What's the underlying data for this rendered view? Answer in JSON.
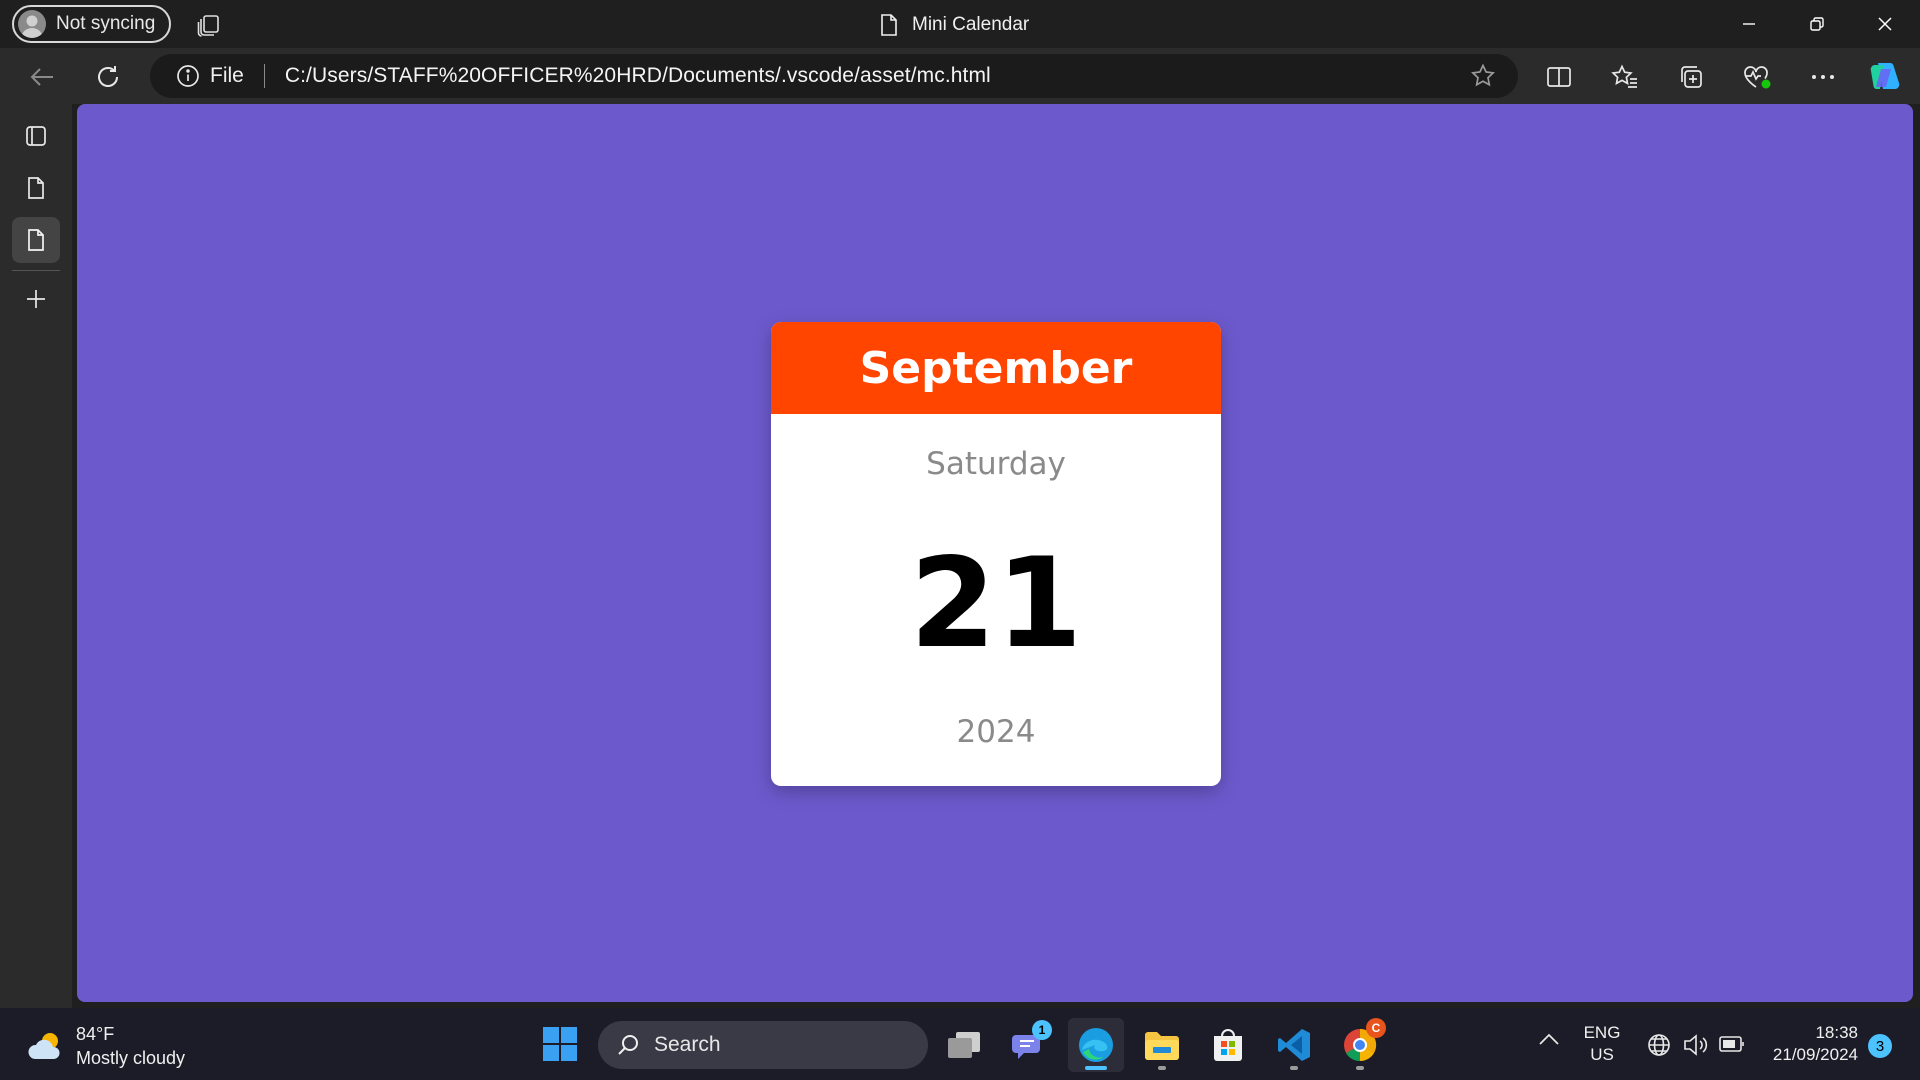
{
  "browser": {
    "profile_label": "Not syncing",
    "window_title": "Mini Calendar",
    "address": {
      "site_info_label": "File",
      "url": "C:/Users/STAFF%20OFFICER%20HRD/Documents/.vscode/asset/mc.html"
    },
    "icons": {
      "back": "back-arrow-icon",
      "refresh": "refresh-icon",
      "site_info": "info-icon",
      "favorite": "star-icon",
      "split_screen": "split-screen-icon",
      "favorites": "favorites-icon",
      "collections": "collections-icon",
      "browser_essentials": "heart-pulse-icon",
      "more": "more-icon",
      "copilot": "copilot-icon"
    },
    "sidebar_tabs": [
      "tab-actions-icon",
      "page-tab-icon",
      "page-tab-icon-active",
      "new-tab-icon"
    ]
  },
  "calendar": {
    "month": "September",
    "weekday": "Saturday",
    "day": "21",
    "year": "2024",
    "colors": {
      "background": "#6c5acd",
      "header": "#ff4500"
    }
  },
  "taskbar": {
    "weather": {
      "temp": "84°F",
      "condition": "Mostly cloudy"
    },
    "search_label": "Search",
    "apps": [
      {
        "name": "task-view"
      },
      {
        "name": "teams-chat",
        "badge": "1"
      },
      {
        "name": "edge",
        "active": true
      },
      {
        "name": "file-explorer"
      },
      {
        "name": "microsoft-store"
      },
      {
        "name": "vs-code"
      },
      {
        "name": "chrome",
        "badge": "C"
      }
    ],
    "tray": {
      "lang_line1": "ENG",
      "lang_line2": "US",
      "time": "18:38",
      "date": "21/09/2024",
      "notifications": "3"
    }
  }
}
